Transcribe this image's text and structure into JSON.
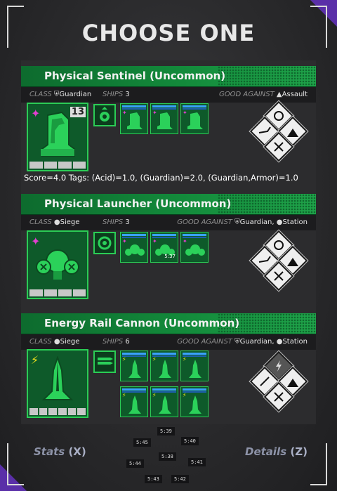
{
  "title": "CHOOSE ONE",
  "cards": [
    {
      "name": "Physical Sentinel (Uncommon)",
      "class_label": "CLASS",
      "class_value": "Guardian",
      "ships_label": "SHIPS",
      "ships_value": "3",
      "good_against_label": "GOOD AGAINST",
      "good_against": [
        "Assault"
      ],
      "level_badge": "13",
      "damage_type_icon": "spark-icon",
      "ship_count_shown": 3
    },
    {
      "name": "Physical Launcher (Uncommon)",
      "class_label": "CLASS",
      "class_value": "Siege",
      "ships_label": "SHIPS",
      "ships_value": "3",
      "good_against_label": "GOOD AGAINST",
      "good_against": [
        "Guardian,",
        "Station"
      ],
      "mini_timer": "5:37",
      "damage_type_icon": "spark-icon",
      "ship_count_shown": 3
    },
    {
      "name": "Energy Rail Cannon (Uncommon)",
      "class_label": "CLASS",
      "class_value": "Siege",
      "ships_label": "SHIPS",
      "ships_value": "6",
      "good_against_label": "GOOD AGAINST",
      "good_against": [
        "Guardian,",
        "Station"
      ],
      "damage_type_icon": "lightning-icon",
      "ship_count_shown": 6
    }
  ],
  "score_text": "Score=4.0 Tags: (Acid)=1.0, (Guardian)=2.0, (Guardian,Armor)=1.0",
  "buttons": {
    "stats_label": "Stats",
    "stats_key": "(X)",
    "details_label": "Details",
    "details_key": "(Z)"
  },
  "timers": [
    "5:39",
    "5:45",
    "5:40",
    "5:38",
    "5:44",
    "5:41",
    "5:43",
    "5:42"
  ],
  "colors": {
    "card_green": "#138a3b",
    "border_green": "#2bcc55",
    "accent_purple": "#5a2fa8",
    "physical_pink": "#e23fd0",
    "energy_yellow": "#f2e21a"
  }
}
